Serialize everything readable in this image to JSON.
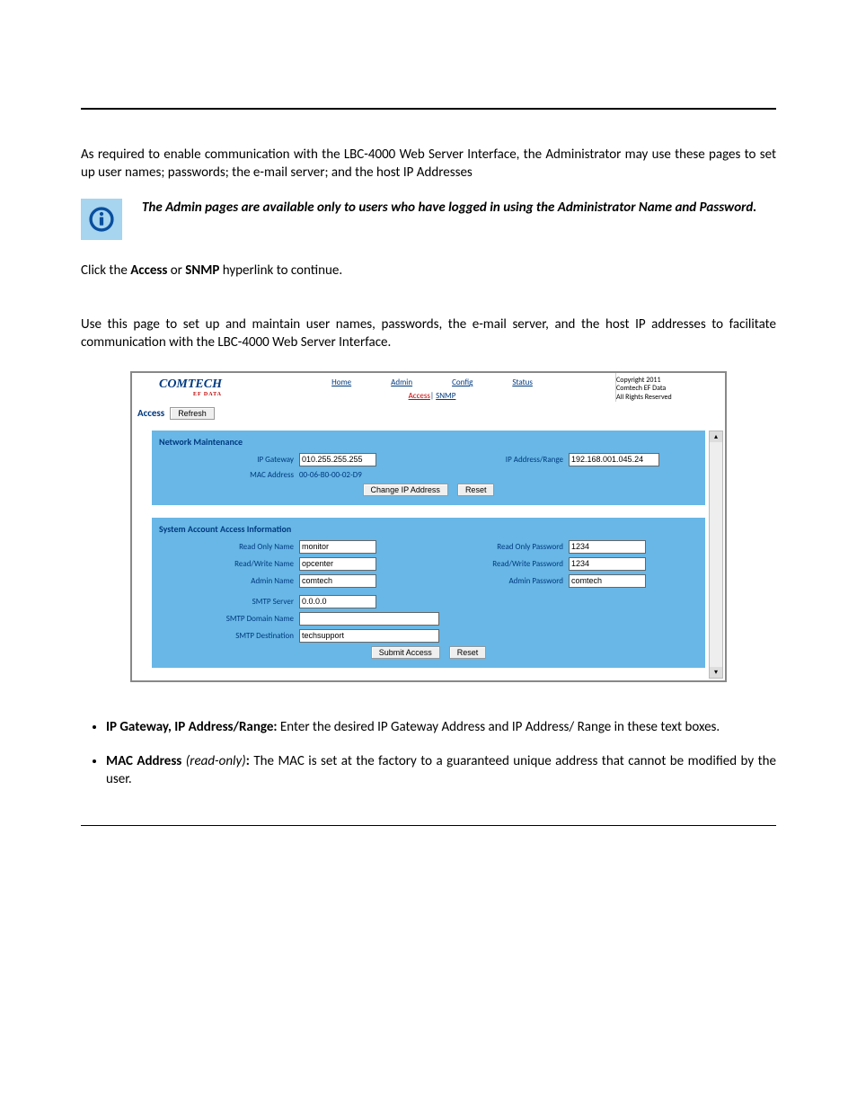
{
  "paragraphs": {
    "intro": "As required to enable communication with the LBC-4000 Web Server Interface, the Administrator may use these pages to set up user names; passwords; the e-mail server; and the host IP Addresses",
    "callout": "The Admin pages are available only to users who have logged in using the Administrator Name and Password.",
    "click_pre": "Click the ",
    "click_b1": "Access",
    "click_mid": " or ",
    "click_b2": "SNMP",
    "click_post": " hyperlink to continue.",
    "use_page": "Use this page to set up and maintain user names, passwords, the e-mail server, and the host IP addresses to facilitate communication with the LBC-4000 Web Server Interface."
  },
  "ui": {
    "logo": "COMTECH",
    "logo_sub": "EF DATA",
    "tabs": [
      "Home",
      "Admin",
      "Config",
      "Status"
    ],
    "sublinks": {
      "active": "Access",
      "other": "SNMP",
      "sep": "| "
    },
    "copyright": [
      "Copyright 2011",
      "Comtech EF Data",
      "All Rights Reserved"
    ],
    "access_title": "Access",
    "refresh_btn": "Refresh",
    "section1": {
      "title": "Network Maintenance",
      "ip_gateway_lbl": "IP Gateway",
      "ip_gateway_val": "010.255.255.255",
      "ip_addr_lbl": "IP Address/Range",
      "ip_addr_val": "192.168.001.045.24",
      "mac_lbl": "MAC Address",
      "mac_val": "00-06-B0-00-02-D9",
      "btn_change": "Change IP Address",
      "btn_reset": "Reset"
    },
    "section2": {
      "title": "System Account Access Information",
      "ro_name_lbl": "Read Only Name",
      "ro_name_val": "monitor",
      "ro_pw_lbl": "Read Only Password",
      "ro_pw_val": "1234",
      "rw_name_lbl": "Read/Write Name",
      "rw_name_val": "opcenter",
      "rw_pw_lbl": "Read/Write Password",
      "rw_pw_val": "1234",
      "admin_name_lbl": "Admin Name",
      "admin_name_val": "comtech",
      "admin_pw_lbl": "Admin Password",
      "admin_pw_val": "comtech",
      "smtp_server_lbl": "SMTP Server",
      "smtp_server_val": "0.0.0.0",
      "smtp_domain_lbl": "SMTP Domain Name",
      "smtp_domain_val": "",
      "smtp_dest_lbl": "SMTP Destination",
      "smtp_dest_val": "techsupport",
      "btn_submit": "Submit Access",
      "btn_reset": "Reset"
    }
  },
  "bullets": {
    "b1_strong": "IP Gateway, IP Address/Range:",
    "b1_rest": " Enter the desired IP Gateway Address and IP Address/ Range in these text boxes.",
    "b2_strong": "MAC Address",
    "b2_ital": " (read-only)",
    "b2_colon": ":",
    "b2_rest": " The MAC is set at the factory to a guaranteed unique address that cannot be modified by the user."
  }
}
